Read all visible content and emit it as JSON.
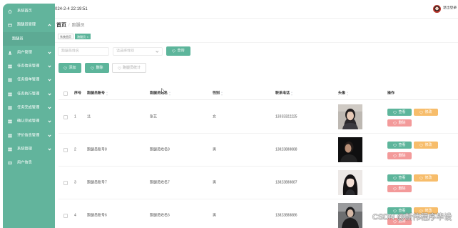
{
  "colors": {
    "sidebar_bg": "#62b49c",
    "primary": "#5db59b",
    "warning": "#f7bd6b",
    "danger": "#f39a9a",
    "logout_avatar": "#b8372c"
  },
  "header": {
    "datetime": "024-2-4 22:19:51",
    "logout_label": "退出登录"
  },
  "sidebar": {
    "items": [
      {
        "label": "系统首页",
        "icon": "home-icon"
      },
      {
        "label": "跑腿员管理",
        "icon": "folder-icon",
        "expanded": true
      },
      {
        "label": "跑腿员",
        "active": true
      },
      {
        "label": "用户管理",
        "icon": "user-icon"
      },
      {
        "label": "任务信息管理",
        "icon": "grid-icon"
      },
      {
        "label": "任务接单管理",
        "icon": "grid-icon"
      },
      {
        "label": "任务执行管理",
        "icon": "grid-icon"
      },
      {
        "label": "任务完成管理",
        "icon": "grid-icon"
      },
      {
        "label": "确认完成管理",
        "icon": "grid-icon"
      },
      {
        "label": "评价信息管理",
        "icon": "grid-icon"
      },
      {
        "label": "系统管理",
        "icon": "grid-icon"
      },
      {
        "label": "用户信息",
        "icon": "card-icon"
      }
    ]
  },
  "breadcrumb": {
    "home": "首页",
    "separator": "/",
    "current": "跑腿员"
  },
  "tabs": [
    {
      "label": "系统首页"
    },
    {
      "label": "跑腿员",
      "close": "×",
      "active": true
    }
  ],
  "search": {
    "name_placeholder": "跑腿员姓名",
    "gender_placeholder": "请选择性别",
    "query_label": "查询",
    "icon": "heart-icon"
  },
  "actions": {
    "add": "添加",
    "delete": "删除",
    "stats": "跑腿员统计"
  },
  "table": {
    "columns": [
      "序号",
      "跑腿员账号",
      "跑腿员姓名",
      "性别",
      "联系电话",
      "头像",
      "操作"
    ],
    "rows": [
      {
        "index": "1",
        "account": "11",
        "name": "张艺",
        "gender": "女",
        "phone": "13333322225"
      },
      {
        "index": "2",
        "account": "跑腿员账号8",
        "name": "跑腿员姓名8",
        "gender": "男",
        "phone": "13823888888"
      },
      {
        "index": "3",
        "account": "跑腿员账号7",
        "name": "跑腿员姓名7",
        "gender": "男",
        "phone": "13823888887"
      },
      {
        "index": "4",
        "account": "跑腿员账号6",
        "name": "跑腿员姓名6",
        "gender": "男",
        "phone": "13823888886"
      }
    ]
  },
  "row_actions": {
    "view": "查看",
    "edit": "修改",
    "delete": "删除"
  },
  "watermark": "CSDN @新伟程序毕设"
}
